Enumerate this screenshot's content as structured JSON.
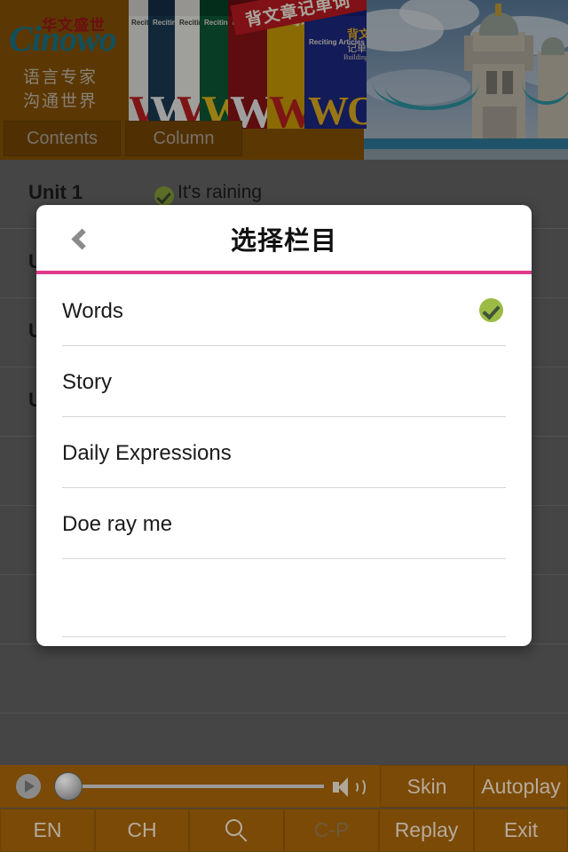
{
  "banner": {
    "logo": {
      "cn_top": "华文盛世",
      "brand": "Cinowo",
      "sub_line1": "语言专家",
      "sub_line2": "沟通世界"
    },
    "book_banner_text": "背文章记单词",
    "book_spine_text": "Reciting Articles",
    "book_cover_cn1": "背文章",
    "book_cover_cn2": "记单词",
    "book_cover_en": "Building Vocabulary",
    "book_cover_word": "WORD"
  },
  "tabs": [
    {
      "label": "Contents",
      "name": "tab-contents"
    },
    {
      "label": "Column",
      "name": "tab-column"
    }
  ],
  "background_list": {
    "rows": [
      {
        "unit": "Unit 1",
        "title": "It's raining",
        "checked": true
      },
      {
        "unit": "U",
        "title": "",
        "checked": false
      },
      {
        "unit": "U",
        "title": "",
        "checked": false
      },
      {
        "unit": "U",
        "title": "",
        "checked": false
      },
      {
        "unit": "",
        "title": "",
        "checked": false
      },
      {
        "unit": "",
        "title": "",
        "checked": false
      },
      {
        "unit": "",
        "title": "",
        "checked": false
      },
      {
        "unit": "",
        "title": "",
        "checked": false
      }
    ]
  },
  "modal": {
    "title": "选择栏目",
    "back_label": "Back",
    "accent_color": "#e0398a",
    "check_color": "#9cbb45",
    "options": [
      {
        "label": "Words",
        "selected": true
      },
      {
        "label": "Story",
        "selected": false
      },
      {
        "label": "Daily Expressions",
        "selected": false
      },
      {
        "label": "Doe ray me",
        "selected": false
      },
      {
        "label": "",
        "selected": false
      }
    ]
  },
  "player": {
    "play_icon": "play-icon",
    "volume_icon": "volume-icon",
    "progress_percent": 0
  },
  "toolbar": {
    "row1": [
      {
        "label": "Skin",
        "name": "skin-button",
        "enabled": true
      },
      {
        "label": "Autoplay",
        "name": "autoplay-button",
        "enabled": true
      }
    ],
    "row2": [
      {
        "label": "EN",
        "name": "en-button",
        "enabled": true
      },
      {
        "label": "CH",
        "name": "ch-button",
        "enabled": true
      },
      {
        "label": "",
        "name": "search-button",
        "enabled": true
      },
      {
        "label": "C-P",
        "name": "cp-button",
        "enabled": false
      },
      {
        "label": "Replay",
        "name": "replay-button",
        "enabled": true
      },
      {
        "label": "Exit",
        "name": "exit-button",
        "enabled": true
      }
    ]
  },
  "colors": {
    "brand_brown": "#7a4a06",
    "banner_brown": "#8a5406",
    "accent_pink": "#e0398a",
    "check_green": "#9cbb45",
    "scrim": "rgba(0,0,0,0.34)"
  }
}
